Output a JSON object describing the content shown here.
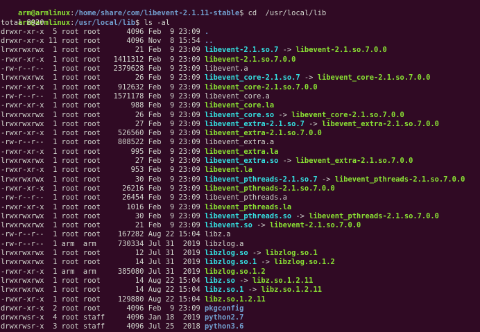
{
  "prompts": [
    {
      "user": "arm@armlinux",
      "path": "/home/share/com/libevent-2.1.11-stable",
      "symbol": "$",
      "command": " cd  /usr/local/lib"
    },
    {
      "user": "arm@armlinux",
      "path": "/usr/local/lib",
      "symbol": "$",
      "command": " ls -al"
    }
  ],
  "total_line": "total 8920",
  "entries": [
    {
      "perm": "drwxr-xr-x",
      "links": "5",
      "owner": "root",
      "group": "root",
      "size": "4096",
      "date": "Feb  9 23:09",
      "name": ".",
      "kind": "dir",
      "target": ""
    },
    {
      "perm": "drwxr-xr-x",
      "links": "11",
      "owner": "root",
      "group": "root",
      "size": "4096",
      "date": "Nov  8 15:54",
      "name": "..",
      "kind": "dir",
      "target": ""
    },
    {
      "perm": "lrwxrwxrwx",
      "links": "1",
      "owner": "root",
      "group": "root",
      "size": "21",
      "date": "Feb  9 23:09",
      "name": "libevent-2.1.so.7",
      "kind": "link",
      "target": "libevent-2.1.so.7.0.0",
      "target_kind": "exec"
    },
    {
      "perm": "-rwxr-xr-x",
      "links": "1",
      "owner": "root",
      "group": "root",
      "size": "1411312",
      "date": "Feb  9 23:09",
      "name": "libevent-2.1.so.7.0.0",
      "kind": "exec",
      "target": ""
    },
    {
      "perm": "-rw-r--r--",
      "links": "1",
      "owner": "root",
      "group": "root",
      "size": "2379628",
      "date": "Feb  9 23:09",
      "name": "libevent.a",
      "kind": "plain",
      "target": ""
    },
    {
      "perm": "lrwxrwxrwx",
      "links": "1",
      "owner": "root",
      "group": "root",
      "size": "26",
      "date": "Feb  9 23:09",
      "name": "libevent_core-2.1.so.7",
      "kind": "link",
      "target": "libevent_core-2.1.so.7.0.0",
      "target_kind": "exec"
    },
    {
      "perm": "-rwxr-xr-x",
      "links": "1",
      "owner": "root",
      "group": "root",
      "size": "912632",
      "date": "Feb  9 23:09",
      "name": "libevent_core-2.1.so.7.0.0",
      "kind": "exec",
      "target": ""
    },
    {
      "perm": "-rw-r--r--",
      "links": "1",
      "owner": "root",
      "group": "root",
      "size": "1571178",
      "date": "Feb  9 23:09",
      "name": "libevent_core.a",
      "kind": "plain",
      "target": ""
    },
    {
      "perm": "-rwxr-xr-x",
      "links": "1",
      "owner": "root",
      "group": "root",
      "size": "988",
      "date": "Feb  9 23:09",
      "name": "libevent_core.la",
      "kind": "exec",
      "target": ""
    },
    {
      "perm": "lrwxrwxrwx",
      "links": "1",
      "owner": "root",
      "group": "root",
      "size": "26",
      "date": "Feb  9 23:09",
      "name": "libevent_core.so",
      "kind": "link",
      "target": "libevent_core-2.1.so.7.0.0",
      "target_kind": "exec"
    },
    {
      "perm": "lrwxrwxrwx",
      "links": "1",
      "owner": "root",
      "group": "root",
      "size": "27",
      "date": "Feb  9 23:09",
      "name": "libevent_extra-2.1.so.7",
      "kind": "link",
      "target": "libevent_extra-2.1.so.7.0.0",
      "target_kind": "exec"
    },
    {
      "perm": "-rwxr-xr-x",
      "links": "1",
      "owner": "root",
      "group": "root",
      "size": "526560",
      "date": "Feb  9 23:09",
      "name": "libevent_extra-2.1.so.7.0.0",
      "kind": "exec",
      "target": ""
    },
    {
      "perm": "-rw-r--r--",
      "links": "1",
      "owner": "root",
      "group": "root",
      "size": "808522",
      "date": "Feb  9 23:09",
      "name": "libevent_extra.a",
      "kind": "plain",
      "target": ""
    },
    {
      "perm": "-rwxr-xr-x",
      "links": "1",
      "owner": "root",
      "group": "root",
      "size": "995",
      "date": "Feb  9 23:09",
      "name": "libevent_extra.la",
      "kind": "exec",
      "target": ""
    },
    {
      "perm": "lrwxrwxrwx",
      "links": "1",
      "owner": "root",
      "group": "root",
      "size": "27",
      "date": "Feb  9 23:09",
      "name": "libevent_extra.so",
      "kind": "link",
      "target": "libevent_extra-2.1.so.7.0.0",
      "target_kind": "exec"
    },
    {
      "perm": "-rwxr-xr-x",
      "links": "1",
      "owner": "root",
      "group": "root",
      "size": "953",
      "date": "Feb  9 23:09",
      "name": "libevent.la",
      "kind": "exec",
      "target": ""
    },
    {
      "perm": "lrwxrwxrwx",
      "links": "1",
      "owner": "root",
      "group": "root",
      "size": "30",
      "date": "Feb  9 23:09",
      "name": "libevent_pthreads-2.1.so.7",
      "kind": "link",
      "target": "libevent_pthreads-2.1.so.7.0.0",
      "target_kind": "exec"
    },
    {
      "perm": "-rwxr-xr-x",
      "links": "1",
      "owner": "root",
      "group": "root",
      "size": "26216",
      "date": "Feb  9 23:09",
      "name": "libevent_pthreads-2.1.so.7.0.0",
      "kind": "exec",
      "target": ""
    },
    {
      "perm": "-rw-r--r--",
      "links": "1",
      "owner": "root",
      "group": "root",
      "size": "26454",
      "date": "Feb  9 23:09",
      "name": "libevent_pthreads.a",
      "kind": "plain",
      "target": ""
    },
    {
      "perm": "-rwxr-xr-x",
      "links": "1",
      "owner": "root",
      "group": "root",
      "size": "1016",
      "date": "Feb  9 23:09",
      "name": "libevent_pthreads.la",
      "kind": "exec",
      "target": ""
    },
    {
      "perm": "lrwxrwxrwx",
      "links": "1",
      "owner": "root",
      "group": "root",
      "size": "30",
      "date": "Feb  9 23:09",
      "name": "libevent_pthreads.so",
      "kind": "link",
      "target": "libevent_pthreads-2.1.so.7.0.0",
      "target_kind": "exec"
    },
    {
      "perm": "lrwxrwxrwx",
      "links": "1",
      "owner": "root",
      "group": "root",
      "size": "21",
      "date": "Feb  9 23:09",
      "name": "libevent.so",
      "kind": "link",
      "target": "libevent-2.1.so.7.0.0",
      "target_kind": "exec"
    },
    {
      "perm": "-rw-r--r--",
      "links": "1",
      "owner": "root",
      "group": "root",
      "size": "167282",
      "date": "Aug 22 15:04",
      "name": "libz.a",
      "kind": "plain",
      "target": ""
    },
    {
      "perm": "-rw-r--r--",
      "links": "1",
      "owner": "arm",
      "group": "arm",
      "size": "730334",
      "date": "Jul 31  2019",
      "name": "libzlog.a",
      "kind": "plain",
      "target": ""
    },
    {
      "perm": "lrwxrwxrwx",
      "links": "1",
      "owner": "root",
      "group": "root",
      "size": "12",
      "date": "Jul 31  2019",
      "name": "libzlog.so",
      "kind": "link",
      "target": "libzlog.so.1",
      "target_kind": "exec"
    },
    {
      "perm": "lrwxrwxrwx",
      "links": "1",
      "owner": "root",
      "group": "root",
      "size": "14",
      "date": "Jul 31  2019",
      "name": "libzlog.so.1",
      "kind": "link",
      "target": "libzlog.so.1.2",
      "target_kind": "exec"
    },
    {
      "perm": "-rwxr-xr-x",
      "links": "1",
      "owner": "arm",
      "group": "arm",
      "size": "385080",
      "date": "Jul 31  2019",
      "name": "libzlog.so.1.2",
      "kind": "exec",
      "target": ""
    },
    {
      "perm": "lrwxrwxrwx",
      "links": "1",
      "owner": "root",
      "group": "root",
      "size": "14",
      "date": "Aug 22 15:04",
      "name": "libz.so",
      "kind": "link",
      "target": "libz.so.1.2.11",
      "target_kind": "exec"
    },
    {
      "perm": "lrwxrwxrwx",
      "links": "1",
      "owner": "root",
      "group": "root",
      "size": "14",
      "date": "Aug 22 15:04",
      "name": "libz.so.1",
      "kind": "link",
      "target": "libz.so.1.2.11",
      "target_kind": "exec"
    },
    {
      "perm": "-rwxr-xr-x",
      "links": "1",
      "owner": "root",
      "group": "root",
      "size": "129880",
      "date": "Aug 22 15:04",
      "name": "libz.so.1.2.11",
      "kind": "exec",
      "target": ""
    },
    {
      "perm": "drwxr-xr-x",
      "links": "2",
      "owner": "root",
      "group": "root",
      "size": "4096",
      "date": "Feb  9 23:09",
      "name": "pkgconfig",
      "kind": "dir",
      "target": ""
    },
    {
      "perm": "drwxrwsr-x",
      "links": "4",
      "owner": "root",
      "group": "staff",
      "size": "4096",
      "date": "Jan 18  2019",
      "name": "python2.7",
      "kind": "dir",
      "target": ""
    },
    {
      "perm": "drwxrwsr-x",
      "links": "3",
      "owner": "root",
      "group": "staff",
      "size": "4096",
      "date": "Jul 25  2018",
      "name": "python3.6",
      "kind": "dir",
      "target": ""
    }
  ],
  "colors": {
    "background": "#300a24",
    "text": "#d3d7cf",
    "prompt_user": "#8ae234",
    "prompt_path": "#729fcf",
    "directory": "#729fcf",
    "symlink": "#34e2e2",
    "executable": "#8ae234"
  }
}
